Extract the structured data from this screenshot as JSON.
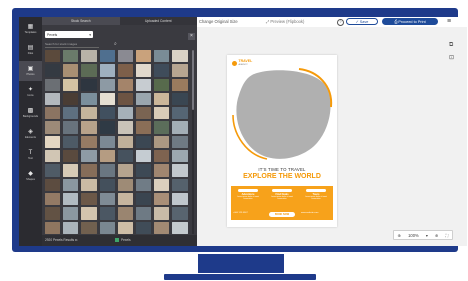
{
  "colors": {
    "frame": "#1e3a8a",
    "accent": "#f59a0a",
    "primary_button": "#1e4b9a",
    "sidebar": "#2b2b30",
    "panel": "#3a3a40"
  },
  "rail": {
    "items": [
      {
        "label": "Templates",
        "icon": "templates-icon",
        "glyph": "▦"
      },
      {
        "label": "Files",
        "icon": "files-icon",
        "glyph": "▤"
      },
      {
        "label": "Photos",
        "icon": "photos-icon",
        "glyph": "▣"
      },
      {
        "label": "Icons",
        "icon": "icons-icon",
        "glyph": "✦"
      },
      {
        "label": "Backgrounds",
        "icon": "backgrounds-icon",
        "glyph": "▩"
      },
      {
        "label": "Elements",
        "icon": "elements-icon",
        "glyph": "◈"
      },
      {
        "label": "Text",
        "icon": "text-icon",
        "glyph": "T"
      },
      {
        "label": "Shapes",
        "icon": "shapes-icon",
        "glyph": "◆"
      }
    ]
  },
  "panel": {
    "tabs": [
      "Stock Search",
      "Uploaded Content"
    ],
    "source": {
      "selected": "Pexels"
    },
    "search": {
      "placeholder": "Search for stock images"
    },
    "footer": {
      "count_label": "2920 Pexels Results",
      "source_label": "Pexels"
    }
  },
  "topbar": {
    "design_name": "Change Original Size",
    "preview_label": "Preview (Flipbook)",
    "save_label": "Save",
    "print_label": "Proceed to Print"
  },
  "flyer": {
    "brand": "TRAVEL",
    "brand_sub": "AGENCY",
    "tagline": "IT'S TIME TO TRAVEL",
    "title": "EXPLORE THE WORLD",
    "columns": [
      {
        "heading": "Adventure",
        "body": "Lorem ipsum dolor sit amet consectetur"
      },
      {
        "heading": "Find Deals",
        "body": "Lorem ipsum dolor sit amet consectetur"
      },
      {
        "heading": "Tours",
        "body": "Lorem ipsum dolor sit amet consectetur"
      }
    ],
    "contact": "+000 123 4567",
    "cta": "BOOK NOW",
    "website": "www.website.com"
  },
  "zoom": {
    "level": "100%"
  },
  "thumb_colors": [
    "#5b4a3c",
    "#6a7b6a",
    "#b9b3a8",
    "#4f6f8f",
    "#8a8a92",
    "#c9a27c",
    "#7a8c96",
    "#d9d2c5",
    "#343a42",
    "#a88f73",
    "#5c6b55",
    "#9fb0bf",
    "#7d5f4a",
    "#e0d8cc",
    "#3f4c5a",
    "#b7a691",
    "#6b6f74",
    "#d4c3a3",
    "#2e3640",
    "#8d9aa4",
    "#a4846a",
    "#c7ccd1",
    "#576a4c",
    "#9b7b5e",
    "#b3b8bd",
    "#4a3d34",
    "#7b8f9c",
    "#e6dfd2",
    "#6d5443",
    "#9aa6ae",
    "#cbb79a",
    "#3a4652",
    "#8b7462",
    "#5e7080",
    "#c4b49c",
    "#41505f",
    "#a6b1b9",
    "#7a6452",
    "#d8ccb8",
    "#556574",
    "#9c8a78",
    "#68737d",
    "#b8a28a",
    "#2f3a45",
    "#c9c3b8",
    "#8a6e57",
    "#5b6d5a",
    "#a3aeb6",
    "#e3d6c2",
    "#4d5a66",
    "#967b64",
    "#7c8994",
    "#c0b09a",
    "#3b4753",
    "#ab9882",
    "#6f7a84",
    "#d1c6b4",
    "#5a4a3e",
    "#8e9ba5",
    "#b59c82",
    "#46525e",
    "#c5ccd2",
    "#7e6350",
    "#9ca8b0",
    "#4f5b66",
    "#d6cab6",
    "#866d59",
    "#6a7681",
    "#b5a48f",
    "#3d4955",
    "#a08670",
    "#c2c8cd",
    "#5c4c40",
    "#8a97a0",
    "#cbbba4",
    "#44505c",
    "#9e8b76",
    "#707c86",
    "#dbcfbd",
    "#55616c",
    "#937a65",
    "#b1bbc2",
    "#6c5848",
    "#7f8b95",
    "#c6b59f",
    "#3a4550",
    "#a98f78",
    "#bfc6cc",
    "#625244",
    "#8b98a1",
    "#d3c4ae",
    "#4b5763",
    "#9a8570",
    "#6e7a84",
    "#c8bba8",
    "#58646f",
    "#8f7660",
    "#aab4bb",
    "#71604f",
    "#7a8791",
    "#cdbda7",
    "#404c58",
    "#a28a74",
    "#c3cace",
    "#5e4e42",
    "#86939c",
    "#d7c9b4",
    "#4e5a65",
    "#987f6a",
    "#727e88",
    "#c1b3a0",
    "#5b6772",
    "#8c735e",
    "#b6bfc5",
    "#6a5847",
    "#808c96",
    "#cbbaa3",
    "#3e4a56",
    "#a58c76",
    "#c0c7cc",
    "#604f43",
    "#88959e",
    "#d5c7b2",
    "#4c5864",
    "#967d68",
    "#707c86",
    "#c4b6a2",
    "#59656f"
  ]
}
